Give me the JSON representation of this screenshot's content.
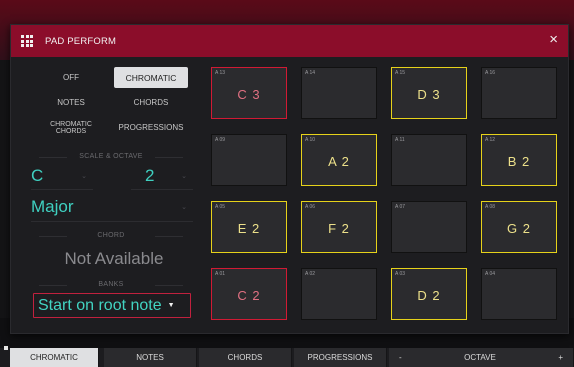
{
  "dialog": {
    "title": "PAD PERFORM",
    "close_label": "×"
  },
  "modes": [
    {
      "label": "OFF",
      "selected": false
    },
    {
      "label": "CHROMATIC",
      "selected": true
    },
    {
      "label": "NOTES",
      "selected": false
    },
    {
      "label": "CHORDS",
      "selected": false
    },
    {
      "label": "CHROMATIC CHORDS",
      "selected": false
    },
    {
      "label": "PROGRESSIONS",
      "selected": false
    }
  ],
  "scale_octave": {
    "section_label": "SCALE & OCTAVE",
    "root": "C",
    "octave": "2",
    "scale": "Major"
  },
  "chord": {
    "section_label": "CHORD",
    "value": "Not Available"
  },
  "banks": {
    "section_label": "BANKS",
    "value": "Start on root note"
  },
  "pads": [
    {
      "id": "A 13",
      "note": "C 3",
      "highlight": "red"
    },
    {
      "id": "A 14",
      "note": "",
      "highlight": "none"
    },
    {
      "id": "A 15",
      "note": "D 3",
      "highlight": "yellow"
    },
    {
      "id": "A 16",
      "note": "",
      "highlight": "none"
    },
    {
      "id": "A 09",
      "note": "",
      "highlight": "none"
    },
    {
      "id": "A 10",
      "note": "A 2",
      "highlight": "yellow"
    },
    {
      "id": "A 11",
      "note": "",
      "highlight": "none"
    },
    {
      "id": "A 12",
      "note": "B 2",
      "highlight": "yellow"
    },
    {
      "id": "A 05",
      "note": "E 2",
      "highlight": "yellow"
    },
    {
      "id": "A 06",
      "note": "F 2",
      "highlight": "yellow"
    },
    {
      "id": "A 07",
      "note": "",
      "highlight": "none"
    },
    {
      "id": "A 08",
      "note": "G 2",
      "highlight": "yellow"
    },
    {
      "id": "A 01",
      "note": "C 2",
      "highlight": "red"
    },
    {
      "id": "A 02",
      "note": "",
      "highlight": "none"
    },
    {
      "id": "A 03",
      "note": "D 2",
      "highlight": "yellow"
    },
    {
      "id": "A 04",
      "note": "",
      "highlight": "none"
    }
  ],
  "bottom_tabs": {
    "chromatic": "CHROMATIC",
    "notes": "NOTES",
    "chords": "CHORDS",
    "progressions": "PROGRESSIONS",
    "octave_minus": "-",
    "octave_label": "OCTAVE",
    "octave_plus": "+"
  },
  "colors": {
    "title_bar": "#8b0d2a",
    "accent_teal": "#42d4c2",
    "scale_highlight": "#e6d21a",
    "root_highlight": "#d11a34"
  }
}
